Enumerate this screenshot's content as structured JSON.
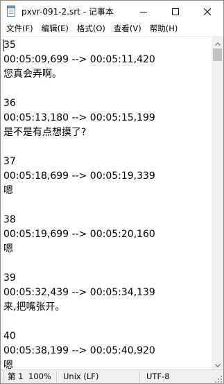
{
  "window": {
    "title": "pxvr-091-2.srt - 记事本"
  },
  "menu": [
    {
      "label": "文件(F)"
    },
    {
      "label": "编辑(E)"
    },
    {
      "label": "格式(O)"
    },
    {
      "label": "查看(V)"
    },
    {
      "label": "帮助(H)"
    }
  ],
  "editor": {
    "lines": [
      "35",
      "00:05:09,699 --> 00:05:11,420",
      "您真会弄啊。",
      "",
      "36",
      "00:05:13,180 --> 00:05:15,199",
      "是不是有点想摸了?",
      "",
      "37",
      "00:05:18,699 --> 00:05:19,339",
      "嗯",
      "",
      "38",
      "00:05:19,699 --> 00:05:20,160",
      "嗯",
      "",
      "39",
      "00:05:32,439 --> 00:05:34,139",
      "来,把嘴张开。",
      "",
      "40",
      "00:05:38,199 --> 00:05:40,920",
      "嗯"
    ]
  },
  "statusbar": {
    "position": "第 1",
    "zoom": "100%",
    "line_ending": "Unix (LF)",
    "encoding": "UTF-8"
  },
  "icons": {
    "app": "notepad-icon",
    "minimize": "minimize-icon",
    "maximize": "maximize-icon",
    "close": "close-icon"
  }
}
